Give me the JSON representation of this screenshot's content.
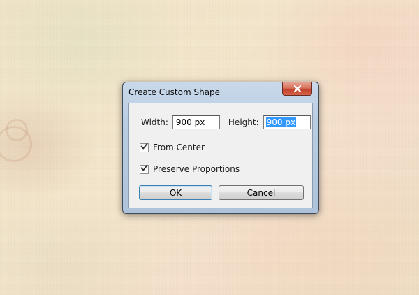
{
  "dialog": {
    "title": "Create Custom Shape",
    "width_label": "Width:",
    "width_value": "900 px",
    "height_label": "Height:",
    "height_value": "900 px",
    "from_center_label": "From Center",
    "from_center_checked": true,
    "preserve_proportions_label": "Preserve Proportions",
    "preserve_proportions_checked": true,
    "ok_label": "OK",
    "cancel_label": "Cancel"
  },
  "icons": {
    "close": "close-icon",
    "check": "checkmark-icon"
  },
  "colors": {
    "selection": "#3399ff",
    "close_button": "#c2412a"
  }
}
